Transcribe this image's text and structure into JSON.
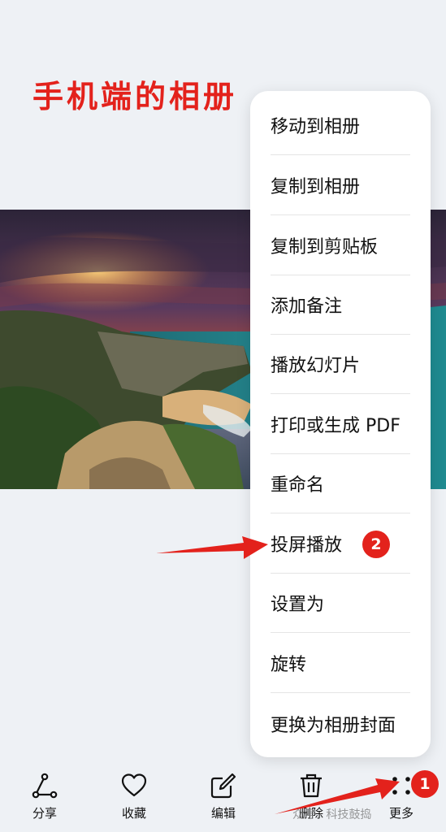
{
  "page_title": "手机端的相册",
  "menu": {
    "items": [
      {
        "label": "移动到相册"
      },
      {
        "label": "复制到相册"
      },
      {
        "label": "复制到剪贴板"
      },
      {
        "label": "添加备注"
      },
      {
        "label": "播放幻灯片"
      },
      {
        "label": "打印或生成 PDF"
      },
      {
        "label": "重命名"
      },
      {
        "label": "投屏播放"
      },
      {
        "label": "设置为"
      },
      {
        "label": "旋转"
      },
      {
        "label": "更换为相册封面"
      }
    ]
  },
  "badges": {
    "more": "1",
    "cast": "2"
  },
  "toolbar": {
    "share": "分享",
    "favorite": "收藏",
    "edit": "编辑",
    "delete": "删除",
    "more": "更多"
  },
  "watermark": "众号 · 科技鼓捣",
  "colors": {
    "annotation": "#e3221c",
    "menu_bg": "#ffffff",
    "page_bg": "#eef1f5"
  }
}
